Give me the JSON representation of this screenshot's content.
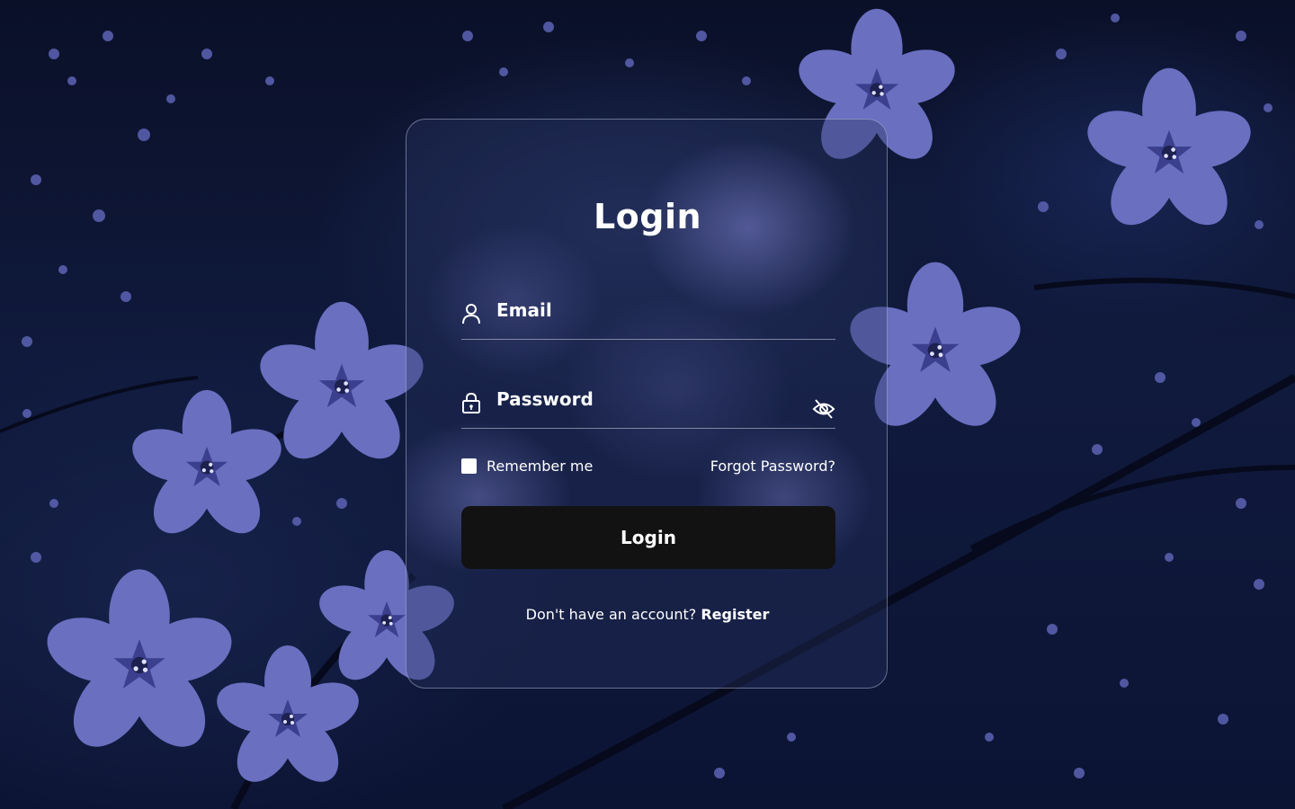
{
  "colors": {
    "background": "#0b1230",
    "blossom": "#6a6fc0",
    "button": "#121212",
    "text": "#ffffff"
  },
  "form": {
    "title": "Login",
    "email_label": "Email",
    "email_icon": "user-icon",
    "password_label": "Password",
    "password_icon": "lock-icon",
    "password_toggle_icon": "eye-off-icon",
    "remember_label": "Remember me",
    "remember_checked": false,
    "forgot_label": "Forgot Password?",
    "submit_label": "Login",
    "register_prompt": "Don't have an account?",
    "register_link": "Register"
  }
}
